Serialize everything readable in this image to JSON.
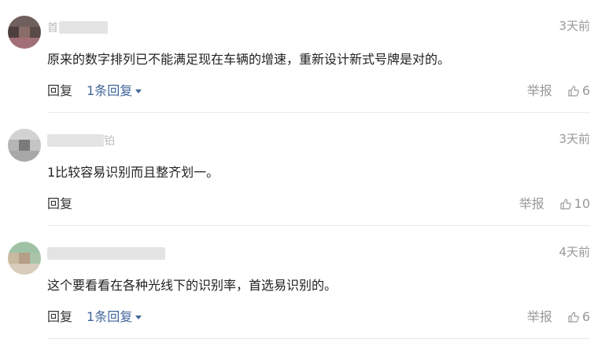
{
  "comments": [
    {
      "user_visible": "首",
      "time": "3天前",
      "text": "原来的数字排列已不能满足现在车辆的增速，重新设计新式号牌是对的。",
      "reply_label": "回复",
      "replies_label": "1条回复",
      "report_label": "举报",
      "likes": "6"
    },
    {
      "user_visible": "铂",
      "time": "3天前",
      "text": "1比较容易识别而且整齐划一。",
      "reply_label": "回复",
      "report_label": "举报",
      "likes": "10"
    },
    {
      "user_visible": "",
      "time": "4天前",
      "text": "这个要看看在各种光线下的识别率，首选易识别的。",
      "reply_label": "回复",
      "replies_label": "1条回复",
      "report_label": "举报",
      "likes": "6"
    }
  ],
  "icons": {
    "like": "thumbs-up-icon",
    "dropdown": "caret-down-icon"
  },
  "colors": {
    "link": "#406599",
    "muted": "#999999",
    "divider": "#e8e8e8"
  }
}
